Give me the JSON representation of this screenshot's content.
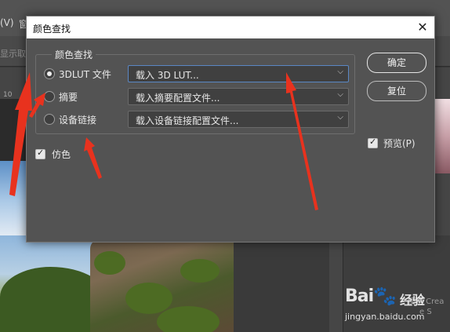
{
  "background": {
    "menu_v": "(V)",
    "menu_ghost": "窗",
    "option_text": "显示取",
    "ruler_number": "10",
    "panel_tab_ghost": "",
    "panel_text_1": "使用 Crea",
    "panel_text_2": "e S",
    "watermark": {
      "logo": "Bai",
      "paw": "🐾",
      "brand": "经验",
      "url": "jingyan.baidu.com"
    }
  },
  "dialog": {
    "title": "颜色查找",
    "close_label": "✕",
    "group_legend": "颜色查找",
    "options": [
      {
        "label": "3DLUT 文件",
        "selected": true,
        "select_value": "载入 3D LUT..."
      },
      {
        "label": "摘要",
        "selected": false,
        "select_value": "载入摘要配置文件..."
      },
      {
        "label": "设备链接",
        "selected": false,
        "select_value": "载入设备链接配置文件..."
      }
    ],
    "dither": {
      "label": "仿色",
      "checked": true
    },
    "buttons": {
      "ok": "确定",
      "reset": "复位"
    },
    "preview": {
      "label": "预览(P)",
      "checked": true
    }
  },
  "colors": {
    "annotation_red": "#e8321e",
    "dialog_bg": "#535353",
    "select_focus": "#5a87c4"
  }
}
